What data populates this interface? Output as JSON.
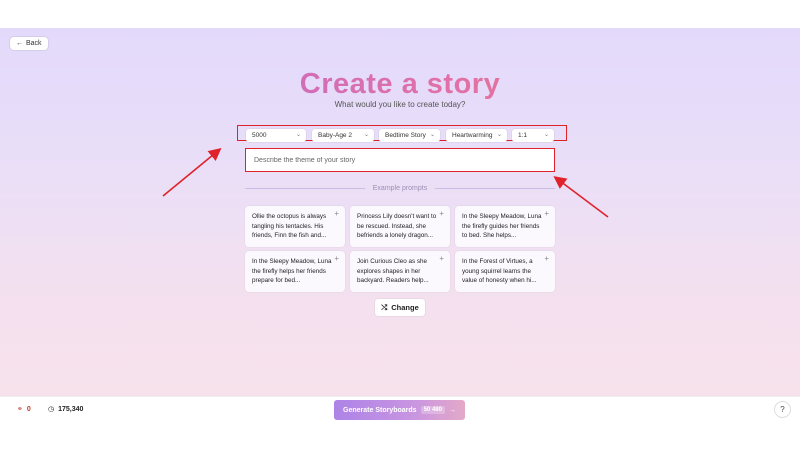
{
  "nav": {
    "back_label": "Back"
  },
  "header": {
    "title": "Create a story",
    "subtitle": "What would you like to create today?"
  },
  "filters": [
    {
      "value": "5000"
    },
    {
      "value": "Baby-Age 2"
    },
    {
      "value": "Bedtime Story"
    },
    {
      "value": "Heartwarming"
    },
    {
      "value": "1:1"
    }
  ],
  "theme_input": {
    "placeholder": "Describe the theme of your story",
    "value": ""
  },
  "examples": {
    "heading": "Example prompts",
    "cards": [
      "Ollie the octopus is always tangling his tentacles. His friends, Finn the fish and...",
      "Princess Lily doesn't want to be rescued. Instead, she befriends a lonely dragon...",
      "In the Sleepy Meadow, Luna the firefly guides her friends to bed. She helps...",
      "In the Sleepy Meadow, Luna the firefly helps her friends prepare for bed...",
      "Join Curious Cleo as she explores shapes in her backyard. Readers help...",
      "In the Forest of Virtues, a young squirrel learns the value of honesty when hi..."
    ],
    "change_label": "Change"
  },
  "footer": {
    "stat_a": "0",
    "stat_b": "175,340",
    "generate_label": "Generate Storyboards",
    "generate_cost": "50",
    "generate_cost_unit": "480"
  },
  "colors": {
    "accent": "#b36ad6",
    "annotation_red": "#e0222a"
  }
}
